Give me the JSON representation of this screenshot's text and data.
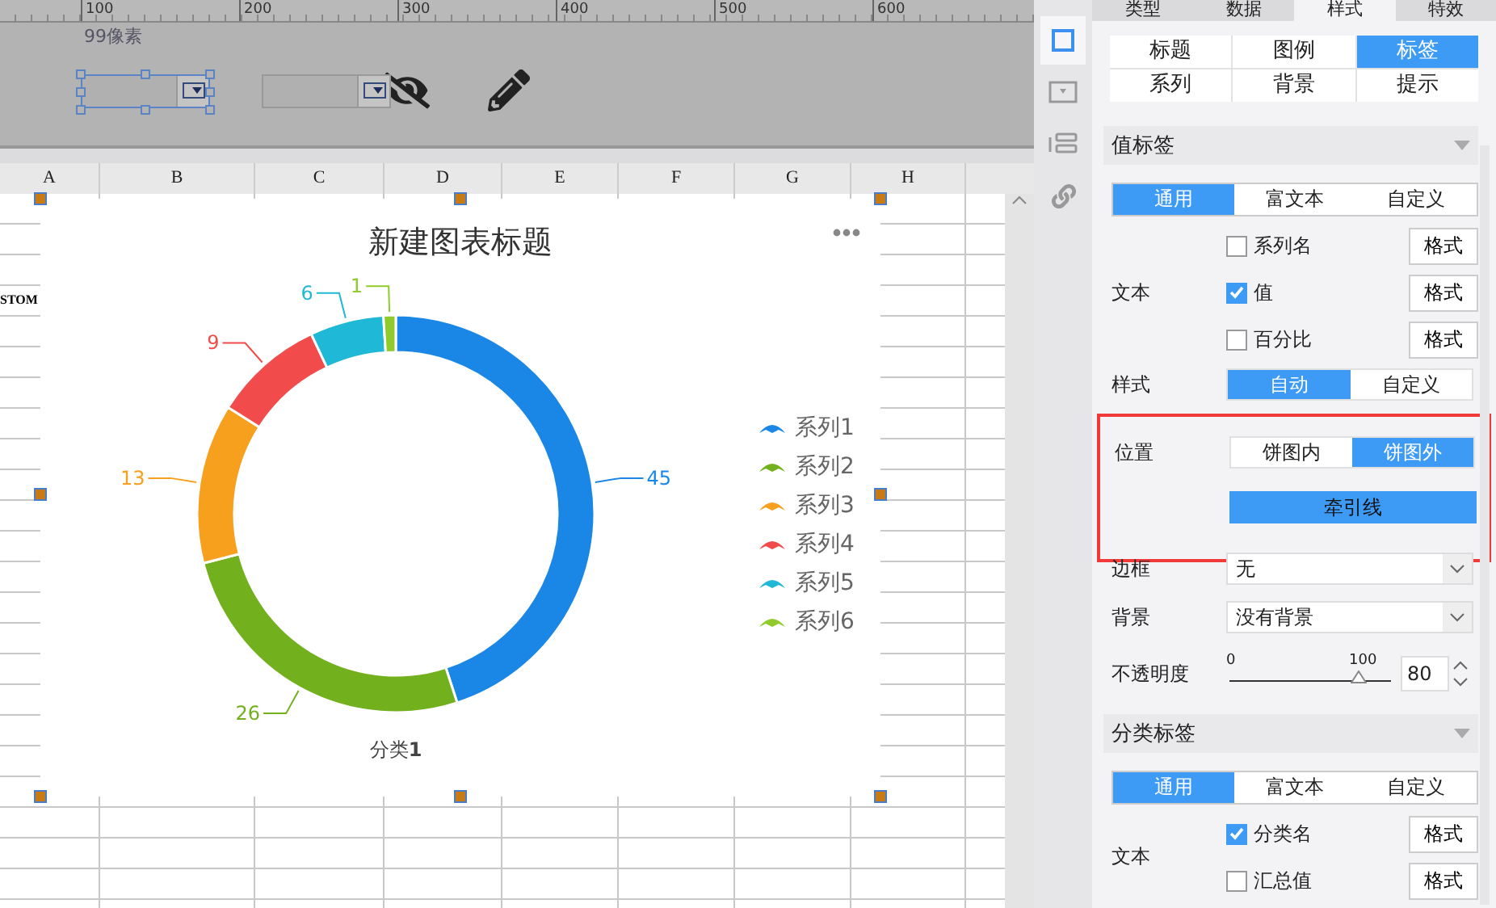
{
  "ruler": {
    "labels": [
      "100",
      "200",
      "300",
      "400",
      "500",
      "600"
    ]
  },
  "toolbar": {
    "size_label": "99像素",
    "widgets": [
      {
        "selected": true
      },
      {
        "selected": false
      }
    ]
  },
  "sheet": {
    "columns": [
      "A",
      "B",
      "C",
      "D",
      "E",
      "F",
      "G",
      "H"
    ],
    "cell_text": "STOM"
  },
  "chart": {
    "title": "新建图表标题",
    "category_label": "分类**1**",
    "slices": [
      {
        "color": "#1a87e6"
      },
      {
        "color": "#72b01d"
      },
      {
        "color": "#f7a01d"
      },
      {
        "color": "#f24b4b"
      },
      {
        "color": "#1fb8d6"
      },
      {
        "color": "#8fcb2a"
      }
    ],
    "chart_data": {
      "type": "donut",
      "categories": [
        "系列1",
        "系列2",
        "系列3",
        "系列4",
        "系列5",
        "系列6"
      ],
      "data_labels": true,
      "series": [
        {
          "values": [
            45,
            26,
            13,
            9,
            6,
            1
          ]
        }
      ]
    }
  },
  "side_icons": [
    {
      "kind": "frame",
      "selected": true
    },
    {
      "kind": "widget",
      "selected": false
    },
    {
      "kind": "layout",
      "selected": false
    },
    {
      "kind": "link",
      "selected": false
    }
  ],
  "tabs": [
    {
      "label": "类型",
      "selected": false
    },
    {
      "label": "数据",
      "selected": false
    },
    {
      "label": "样式",
      "selected": true
    },
    {
      "label": "特效",
      "selected": false
    }
  ],
  "style_tabs": [
    {
      "label": "标题",
      "selected": false
    },
    {
      "label": "图例",
      "selected": false
    },
    {
      "label": "标签",
      "selected": true
    },
    {
      "label": "系列",
      "selected": false
    },
    {
      "label": "背景",
      "selected": false
    },
    {
      "label": "提示",
      "selected": false
    }
  ],
  "value_label": {
    "title": "值标签",
    "modes": [
      {
        "label": "通用",
        "selected": true
      },
      {
        "label": "富文本",
        "selected": false
      },
      {
        "label": "自定义",
        "selected": false
      }
    ],
    "text_label": "文本",
    "text_options": [
      {
        "label": "系列名",
        "checked": false,
        "button": "格式"
      },
      {
        "label": "值",
        "checked": true,
        "button": "格式"
      },
      {
        "label": "百分比",
        "checked": false,
        "button": "格式"
      }
    ],
    "style": {
      "label": "样式",
      "options": [
        {
          "label": "自动",
          "selected": true
        },
        {
          "label": "自定义",
          "selected": false
        }
      ]
    },
    "position": {
      "label": "位置",
      "options": [
        {
          "label": "饼图内",
          "selected": false
        },
        {
          "label": "饼图外",
          "selected": true
        }
      ],
      "leader_line": {
        "label": "牵引线",
        "on": true
      }
    },
    "border": {
      "label": "边框",
      "value": "无"
    },
    "background": {
      "label": "背景",
      "value": "没有背景"
    },
    "opacity": {
      "label": "不透明度",
      "min": "0",
      "max": "100",
      "level": 0.8,
      "value": "80"
    }
  },
  "category_label": {
    "title": "分类标签",
    "modes": [
      {
        "label": "通用",
        "selected": true
      },
      {
        "label": "富文本",
        "selected": false
      },
      {
        "label": "自定义",
        "selected": false
      }
    ],
    "text_label": "文本",
    "text_options": [
      {
        "label": "分类名",
        "checked": true,
        "button": "格式"
      },
      {
        "label": "汇总值",
        "checked": false,
        "button": "格式"
      }
    ]
  }
}
